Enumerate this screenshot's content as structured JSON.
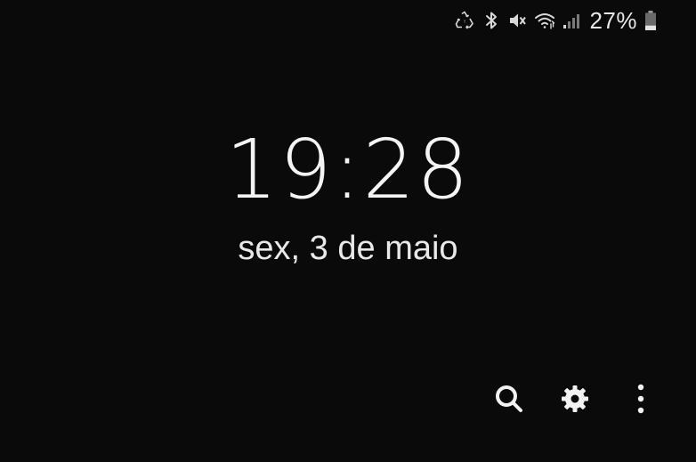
{
  "status_bar": {
    "icons": [
      "recycle-icon",
      "bluetooth-icon",
      "mute-icon",
      "wifi-icon",
      "signal-icon"
    ],
    "battery_percent_label": "27%",
    "battery_level": 0.27
  },
  "clock": {
    "time": "19:28",
    "date": "sex, 3 de maio"
  },
  "actions": {
    "icons": [
      "search-icon",
      "gear-icon",
      "more-vertical-icon"
    ]
  },
  "colors": {
    "background": "#0a0a0a",
    "foreground": "#f2f2f2"
  }
}
